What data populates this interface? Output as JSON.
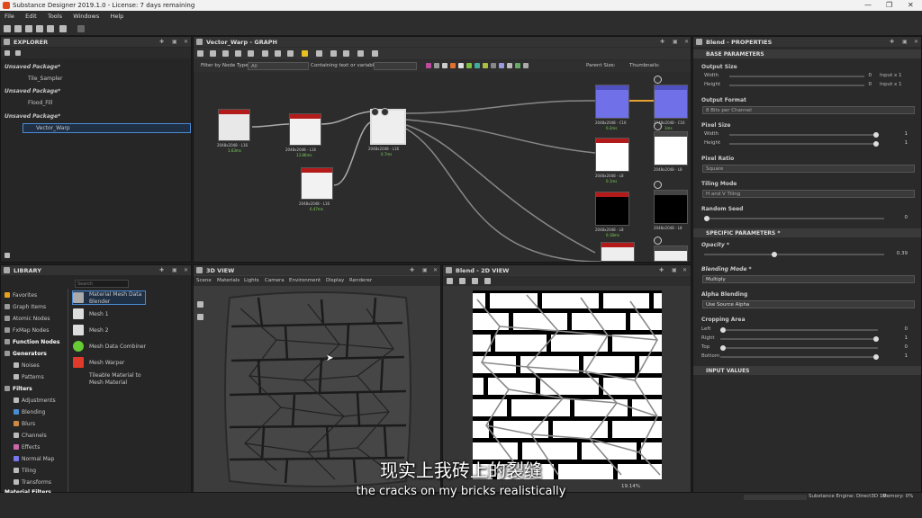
{
  "window": {
    "title": "Substance Designer 2019.1.0 - License: 7 days remaining",
    "minimize": "—",
    "maximize": "❐",
    "close": "✕"
  },
  "menu": [
    "File",
    "Edit",
    "Tools",
    "Windows",
    "Help"
  ],
  "explorer": {
    "title": "EXPLORER",
    "items": [
      "Unsaved Package*",
      "Tile_Sampler",
      "Unsaved Package*",
      "Flood_Fill",
      "Unsaved Package*",
      "Vector_Warp"
    ]
  },
  "graph": {
    "title": "Vector_Warp - GRAPH",
    "filter_label": "Filter by Node Type",
    "filter_value": "All",
    "contain_label": "Containing text or variable",
    "parent_size_label": "Parent Size:",
    "thumbnails_label": "Thumbnails:",
    "nodes": [
      {
        "label": "2048x2048 - L16",
        "time": "1.63ms"
      },
      {
        "label": "2048x2048 - L16",
        "time": "13.86ms"
      },
      {
        "label": "2048x2048 - L16",
        "time": "6.47ms"
      },
      {
        "label": "2048x2048 - L16",
        "time": "0.7ms"
      },
      {
        "label": "2048x2048 - C16",
        "time": "0.2ms"
      },
      {
        "label": "2048x2048 - C16",
        "time": "1ms"
      },
      {
        "label": "2048x2048 - L8",
        "time": "0.1ms"
      },
      {
        "label": "2048x2048 - L8",
        "time": "0ms"
      },
      {
        "label": "2048x2048 - L8",
        "time": "0.18ms"
      },
      {
        "label": "2048x2048 - L8",
        "time": "0ms"
      }
    ]
  },
  "library": {
    "title": "LIBRARY",
    "search_placeholder": "Search",
    "categories": [
      "Favorites",
      "Graph Items",
      "Atomic Nodes",
      "FxMap Nodes",
      "Function Nodes",
      "Generators",
      "Noises",
      "Patterns",
      "Filters",
      "Adjustments",
      "Blending",
      "Blurs",
      "Channels",
      "Effects",
      "Normal Map",
      "Tiling",
      "Transforms",
      "Material Filters"
    ],
    "items": [
      "Material Mesh Data Blender",
      "Mesh 1",
      "Mesh 2",
      "Mesh Data Combiner",
      "Mesh Warper",
      "Tileable Material to Mesh Material"
    ]
  },
  "view3d": {
    "title": "3D VIEW",
    "menu": [
      "Scene",
      "Materials",
      "Lights",
      "Camera",
      "Environment",
      "Display",
      "Renderer"
    ]
  },
  "view2d": {
    "title": "Blend - 2D VIEW",
    "zoom": "19.14%"
  },
  "properties": {
    "title": "Blend - PROPERTIES",
    "base_header": "BASE PARAMETERS",
    "output_size": "Output Size",
    "width": "Width",
    "height": "Height",
    "os_width_val": "0",
    "os_height_val": "0",
    "os_width_mode": "Input x 1",
    "os_height_mode": "Input x 1",
    "output_format": "Output Format",
    "output_format_value": "8 Bits per Channel",
    "pixel_size": "Pixel Size",
    "ps_width_val": "1",
    "ps_height_val": "1",
    "pixel_ratio": "Pixel Ratio",
    "pixel_ratio_value": "Square",
    "tiling_mode": "Tiling Mode",
    "tiling_mode_value": "H and V Tiling",
    "random_seed": "Random Seed",
    "random_seed_val": "0",
    "specific_header": "SPECIFIC PARAMETERS *",
    "opacity": "Opacity *",
    "opacity_val": "0.39",
    "blending_mode": "Blending Mode *",
    "blending_mode_value": "Multiply",
    "alpha_blending": "Alpha Blending",
    "alpha_blending_value": "Use Source Alpha",
    "cropping_area": "Cropping Area",
    "left": "Left",
    "right": "Right",
    "top": "Top",
    "bottom": "Bottom",
    "left_val": "0",
    "right_val": "1",
    "top_val": "0",
    "bottom_val": "1",
    "input_header": "INPUT VALUES"
  },
  "status": {
    "engine": "Substance Engine: Direct3D 10",
    "memory": "Memory: 0%"
  },
  "subtitles": {
    "zh": "现实上我砖上的裂缝",
    "en": "the cracks on my bricks realistically"
  }
}
